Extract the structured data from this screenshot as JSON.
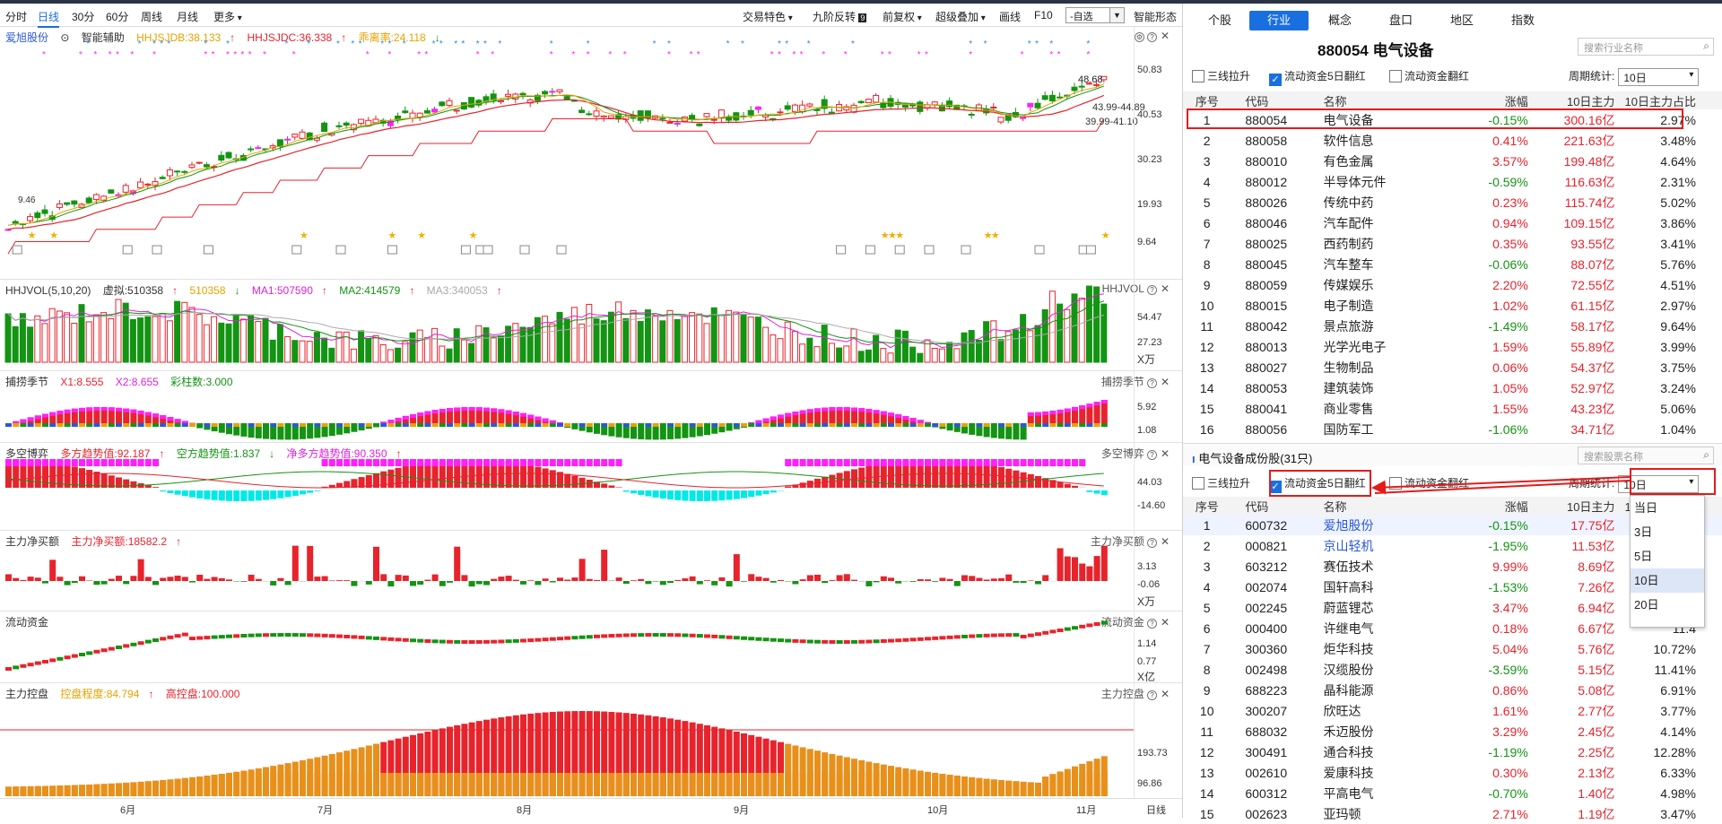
{
  "toolbar": {
    "items": [
      "分时",
      "日线",
      "30分",
      "60分",
      "周线",
      "月线",
      "更多"
    ],
    "right_items": [
      "交易特色",
      "九阶反转",
      "前复权",
      "超级叠加",
      "画线",
      "F10"
    ],
    "self_select": "-自选",
    "smart_form": "智能形态"
  },
  "main_panel": {
    "stock_name": "爱旭股份",
    "assist": "智能辅助",
    "ind1": "HHJSJDB:38.133",
    "ind2": "HHJSJDC:36.338",
    "ind3": "乖离率:24.118",
    "price_high_label": "48.68",
    "price_label_a": "43.99-44.89",
    "price_label_b": "39.99-41.10",
    "low_label": "9.46",
    "y_ticks": [
      "50.83",
      "40.53",
      "30.23",
      "19.93",
      "9.64"
    ]
  },
  "vol_panel": {
    "name": "HHJVOL(5,10,20)",
    "v1": "虚拟:510358",
    "v2": "510358",
    "v3": "MA1:507590",
    "v4": "MA2:414579",
    "v5": "MA3:340053",
    "right_label": "HHJVOL",
    "y_ticks": [
      "54.47",
      "27.23"
    ],
    "unit": "X万"
  },
  "season_panel": {
    "name": "捕捞季节",
    "x1": "X1:8.555",
    "x2": "X2:8.655",
    "bars": "彩柱数:3.000",
    "right_label": "捕捞季节",
    "y_ticks": [
      "5.92",
      "1.08"
    ]
  },
  "game_panel": {
    "name": "多空博弈",
    "a": "多方趋势值:92.187",
    "b": "空方趋势值:1.837",
    "c": "净多方趋势值:90.350",
    "right_label": "多空博弈",
    "y_ticks": [
      "44.03",
      "-14.60"
    ]
  },
  "netbuy_panel": {
    "name": "主力净买额",
    "a": "主力净买额:18582.2",
    "right_label": "主力净买额",
    "y_ticks": [
      "3.13",
      "-0.06"
    ],
    "unit": "X万"
  },
  "flow_panel": {
    "name": "流动资金",
    "right_label": "流动资金",
    "y_ticks": [
      "1.14",
      "0.77"
    ],
    "unit": "X亿"
  },
  "control_panel": {
    "name": "主力控盘",
    "a": "控盘程度:84.794",
    "b": "高控盘:100.000",
    "right_label": "主力控盘",
    "y_ticks": [
      "193.73",
      "96.86"
    ]
  },
  "x_axis": {
    "labels": [
      "6月",
      "7月",
      "8月",
      "9月",
      "10月",
      "11月"
    ],
    "right": "日线"
  },
  "right_panel": {
    "tabs": [
      "个股",
      "行业",
      "概念",
      "盘口",
      "地区",
      "指数"
    ],
    "active_tab": "行业",
    "industry_title": "880054  电气设备",
    "search1": "搜索行业名称",
    "search2": "搜索股票名称",
    "chk_a": "三线拉升",
    "chk_b": "流动资金5日翻红",
    "chk_c": "流动资金翻红",
    "period_label": "周期统计:",
    "period_value": "10日",
    "headers": [
      "序号",
      "代码",
      "名称",
      "涨幅",
      "10日主力",
      "10日主力占比"
    ],
    "section2_title": "电气设备成份股(31只)",
    "dropdown": [
      "当日",
      "3日",
      "5日",
      "10日",
      "20日"
    ]
  },
  "industries": [
    [
      "1",
      "880054",
      "电气设备",
      "-0.15%",
      "300.16亿",
      "2.97%"
    ],
    [
      "2",
      "880058",
      "软件信息",
      "0.41%",
      "221.63亿",
      "3.48%"
    ],
    [
      "3",
      "880010",
      "有色金属",
      "3.57%",
      "199.48亿",
      "4.64%"
    ],
    [
      "4",
      "880012",
      "半导体元件",
      "-0.59%",
      "116.63亿",
      "2.31%"
    ],
    [
      "5",
      "880026",
      "传统中药",
      "0.23%",
      "115.74亿",
      "5.02%"
    ],
    [
      "6",
      "880046",
      "汽车配件",
      "0.94%",
      "109.15亿",
      "3.86%"
    ],
    [
      "7",
      "880025",
      "西药制药",
      "0.35%",
      "93.55亿",
      "3.41%"
    ],
    [
      "8",
      "880045",
      "汽车整车",
      "-0.06%",
      "88.07亿",
      "5.76%"
    ],
    [
      "9",
      "880059",
      "传媒娱乐",
      "2.20%",
      "72.55亿",
      "4.51%"
    ],
    [
      "10",
      "880015",
      "电子制造",
      "1.02%",
      "61.15亿",
      "2.97%"
    ],
    [
      "11",
      "880042",
      "景点旅游",
      "-1.49%",
      "58.17亿",
      "9.64%"
    ],
    [
      "12",
      "880013",
      "光学光电子",
      "1.59%",
      "55.89亿",
      "3.99%"
    ],
    [
      "13",
      "880027",
      "生物制品",
      "0.06%",
      "54.37亿",
      "3.75%"
    ],
    [
      "14",
      "880053",
      "建筑装饰",
      "1.05%",
      "52.97亿",
      "3.24%"
    ],
    [
      "15",
      "880041",
      "商业零售",
      "1.55%",
      "43.23亿",
      "5.06%"
    ],
    [
      "16",
      "880056",
      "国防军工",
      "-1.06%",
      "34.71亿",
      "1.04%"
    ]
  ],
  "stocks": [
    [
      "1",
      "600732",
      "爱旭股份",
      "-0.15%",
      "17.75亿",
      "10."
    ],
    [
      "2",
      "000821",
      "京山轻机",
      "-1.95%",
      "11.53亿",
      "6."
    ],
    [
      "3",
      "603212",
      "赛伍技术",
      "9.99%",
      "8.69亿",
      "20."
    ],
    [
      "4",
      "002074",
      "国轩高科",
      "-1.53%",
      "7.26亿",
      "6."
    ],
    [
      "5",
      "002245",
      "蔚蓝锂芯",
      "3.47%",
      "6.94亿",
      "9."
    ],
    [
      "6",
      "000400",
      "许继电气",
      "0.18%",
      "6.67亿",
      "11.4"
    ],
    [
      "7",
      "300360",
      "炬华科技",
      "5.04%",
      "5.76亿",
      "10.72%"
    ],
    [
      "8",
      "002498",
      "汉缆股份",
      "-3.59%",
      "5.15亿",
      "11.41%"
    ],
    [
      "9",
      "688223",
      "晶科能源",
      "0.86%",
      "5.08亿",
      "6.91%"
    ],
    [
      "10",
      "300207",
      "欣旺达",
      "1.61%",
      "2.77亿",
      "3.77%"
    ],
    [
      "11",
      "688032",
      "禾迈股份",
      "3.29%",
      "2.45亿",
      "4.14%"
    ],
    [
      "12",
      "300491",
      "通合科技",
      "-1.19%",
      "2.25亿",
      "12.28%"
    ],
    [
      "13",
      "002610",
      "爱康科技",
      "0.30%",
      "2.13亿",
      "6.33%"
    ],
    [
      "14",
      "600312",
      "平高电气",
      "-0.70%",
      "1.40亿",
      "4.98%"
    ],
    [
      "15",
      "002623",
      "亚玛顿",
      "2.71%",
      "1.19亿",
      "3.47%"
    ]
  ]
}
